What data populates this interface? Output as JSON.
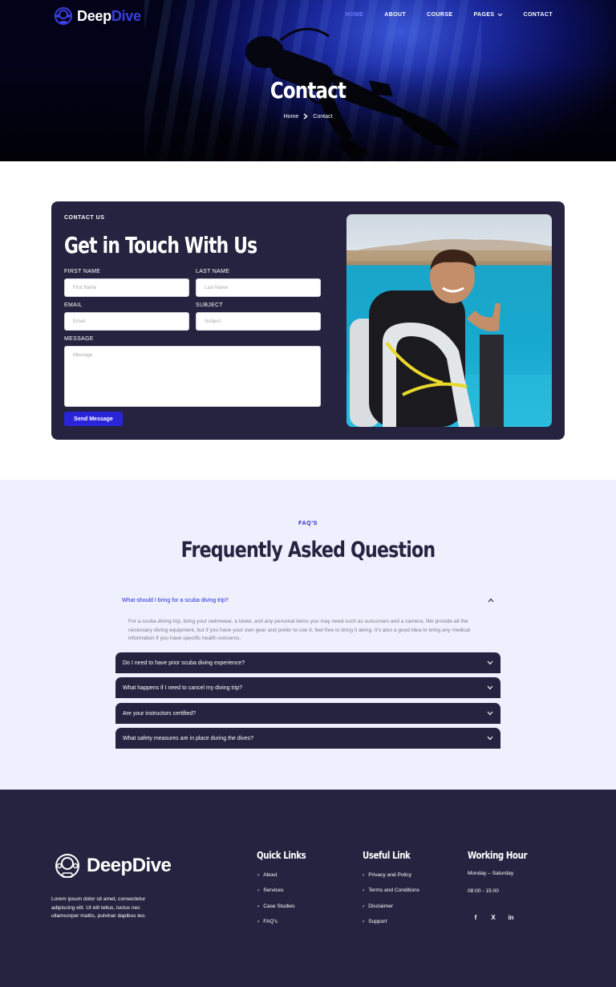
{
  "header": {
    "brand_part1": "Deep",
    "brand_part2": "Dive",
    "nav": [
      "HOME",
      "ABOUT",
      "COURSE",
      "PAGES",
      "CONTACT"
    ],
    "title": "Contact",
    "breadcrumb": [
      "Home",
      "Contact"
    ]
  },
  "contact": {
    "eyebrow": "CONTACT US",
    "title": "Get in Touch With Us",
    "first_name_label": "FIRST NAME",
    "first_name_placeholder": "First Name",
    "last_name_label": "LAST NAME",
    "last_name_placeholder": "Last Name",
    "email_label": "EMAIL",
    "email_placeholder": "Email",
    "subject_label": "SUBJECT",
    "subject_placeholder": "Subject",
    "message_label": "MESSAGE",
    "message_placeholder": "Message",
    "send_label": "Send Message"
  },
  "faq": {
    "eyebrow": "FAQ'S",
    "title": "Frequently Asked Question",
    "open_question": "What should I bring for a scuba diving trip?",
    "open_answer": "For a scuba diving trip, bring your swimwear, a towel, and any personal items you may need such as sunscreen and a camera. We provide all the necessary diving equipment, but if you have your own gear and prefer to use it, feel free to bring it along. It's also a good idea to bring any medical information if you have specific health concerns.",
    "items": [
      "Do I need to have prior scuba diving experience?",
      "What happens if I need to cancel my diving trip?",
      "Are your instructors certified?",
      "What safety measures are in place during the dives?"
    ]
  },
  "footer": {
    "brand": "DeepDive",
    "about": "Lorem ipsum dolor sit amet, consectetur adipiscing elit. Ut elit tellus, luctus nec ullamcorper mattis, pulvinar dapibus leo.",
    "quick_links_title": "Quick Links",
    "quick_links": [
      "About",
      "Services",
      "Case Studies",
      "FAQ's"
    ],
    "useful_title": "Useful Link",
    "useful_links": [
      "Privacy and Policy",
      "Terms and Conditions",
      "Disclaimer",
      "Support"
    ],
    "hours_title": "Working Hour",
    "hours_days": "Monday – Saturday",
    "hours_time": "08:00 - 15:00",
    "social": [
      "f",
      "X",
      "in"
    ]
  },
  "colors": {
    "primary": "#2a24d8",
    "dark": "#25233f",
    "faq_bg": "#eef0fe"
  }
}
